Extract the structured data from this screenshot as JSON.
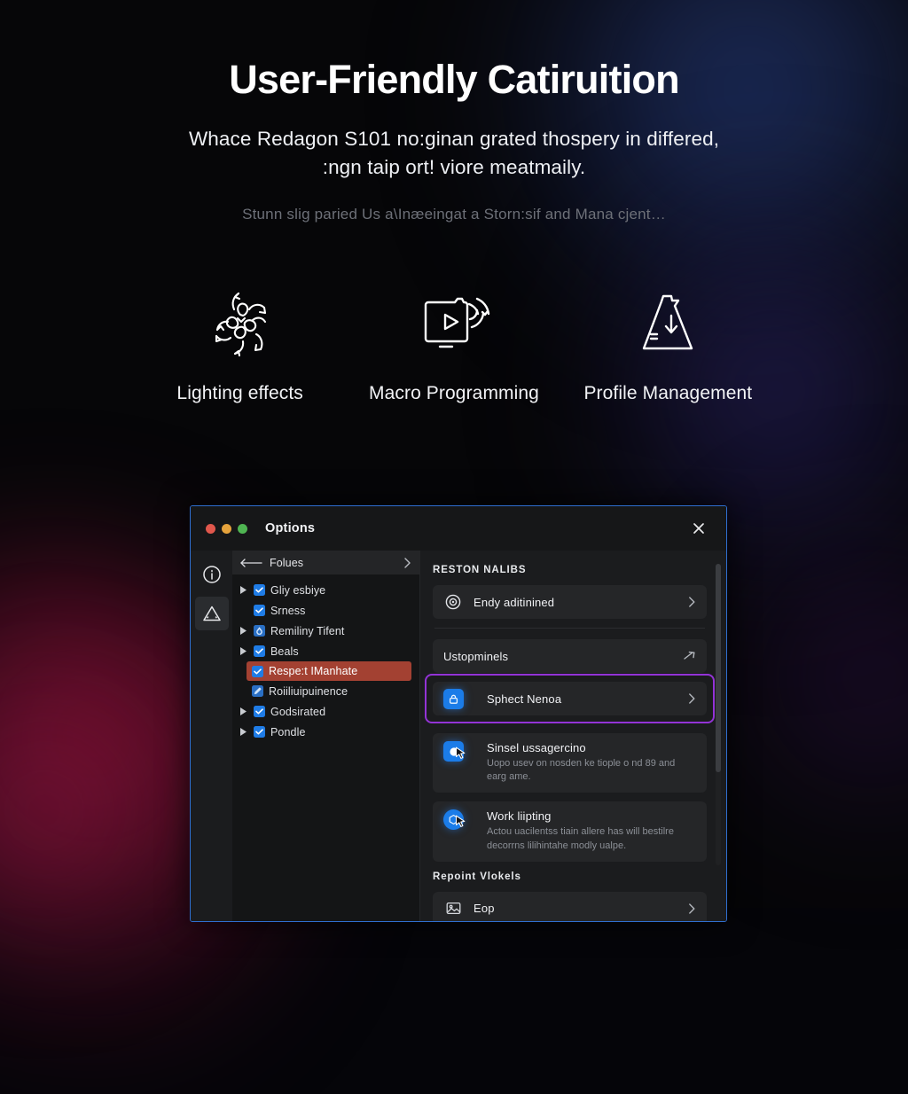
{
  "hero": {
    "title": "User-Friendly Catiruition",
    "subtitle_line1": "Whace Redagon S101 no:ginan grated thospery in differed,",
    "subtitle_line2": ":ngn taip ort! viore meatmaily.",
    "note": "Stunn slig paried Us a\\Inæeingat a Storn:sif and Mana cjent…"
  },
  "features": [
    {
      "label": "Lighting effects",
      "icon": "lighting-effects-icon"
    },
    {
      "label": "Macro Programming",
      "icon": "macro-programming-icon"
    },
    {
      "label": "Profile Management",
      "icon": "profile-management-icon"
    }
  ],
  "dialog": {
    "title": "Options",
    "close_icon": "close-icon",
    "traffic_lights": [
      "close-light",
      "minimize-light",
      "zoom-light"
    ],
    "rail": [
      {
        "icon": "info-circle-icon",
        "active": false
      },
      {
        "icon": "warning-triangle-icon",
        "active": true
      }
    ],
    "tree": {
      "header": "Folues",
      "back_icon": "back-arrow-icon",
      "forward_icon": "chevron-right-icon",
      "items": [
        {
          "label": "Gliy esbiye",
          "expandable": true,
          "checked": true,
          "highlight": false
        },
        {
          "label": "Srness",
          "expandable": false,
          "checked": true,
          "highlight": false
        },
        {
          "label": "Remiliny Tifent",
          "expandable": true,
          "checked": true,
          "highlight": false
        },
        {
          "label": "Beals",
          "expandable": true,
          "checked": true,
          "highlight": false
        },
        {
          "label": "Respe:t IManhate",
          "expandable": false,
          "checked": true,
          "highlight": true
        },
        {
          "label": "Roiiliuipuinence",
          "expandable": false,
          "checked": true,
          "highlight": false
        },
        {
          "label": "Godsirated",
          "expandable": true,
          "checked": true,
          "highlight": false
        },
        {
          "label": "Pondle",
          "expandable": true,
          "checked": true,
          "highlight": false
        }
      ]
    },
    "panel": {
      "section_1_header": "RESTON NALIBS",
      "section_2_header": "Repoint Vlokels",
      "cards": [
        {
          "title": "Endy aditinined",
          "desc": "",
          "icon": "target-circle-icon",
          "chevron": "chevron-right-icon",
          "focused": false
        },
        {
          "title": "Ustopminels",
          "desc": "",
          "icon": "none",
          "chevron": "arrow-right-icon",
          "focused": false
        },
        {
          "title": "Sphect Nenoa",
          "desc": "",
          "icon": "lock-icon",
          "chevron": "chevron-right-icon",
          "focused": true
        },
        {
          "title": "Sinsel ussagercino",
          "desc": "Uopo usev on nosden ke tiople o nd 89 and earg ame.",
          "icon": "blue-dot-icon",
          "chevron": "none",
          "focused": false
        },
        {
          "title": "Work liipting",
          "desc": "Actou uacilentss tiain allere has will bestilre decorrns lilihintahe modly ualpe.",
          "icon": "blue-circle-icon",
          "chevron": "none",
          "focused": false
        }
      ],
      "footer_card": {
        "title": "Eop",
        "icon": "image-icon",
        "chevron": "chevron-right-icon"
      }
    },
    "scrollbar": {
      "name": "vertical-scrollbar"
    }
  },
  "colors": {
    "accent_blue": "#2f6fd0",
    "focus_purple": "#9333d6",
    "highlight_red": "#a34132",
    "checkbox_blue": "#1f7ce6",
    "icon_blue": "#1b7ce8"
  }
}
